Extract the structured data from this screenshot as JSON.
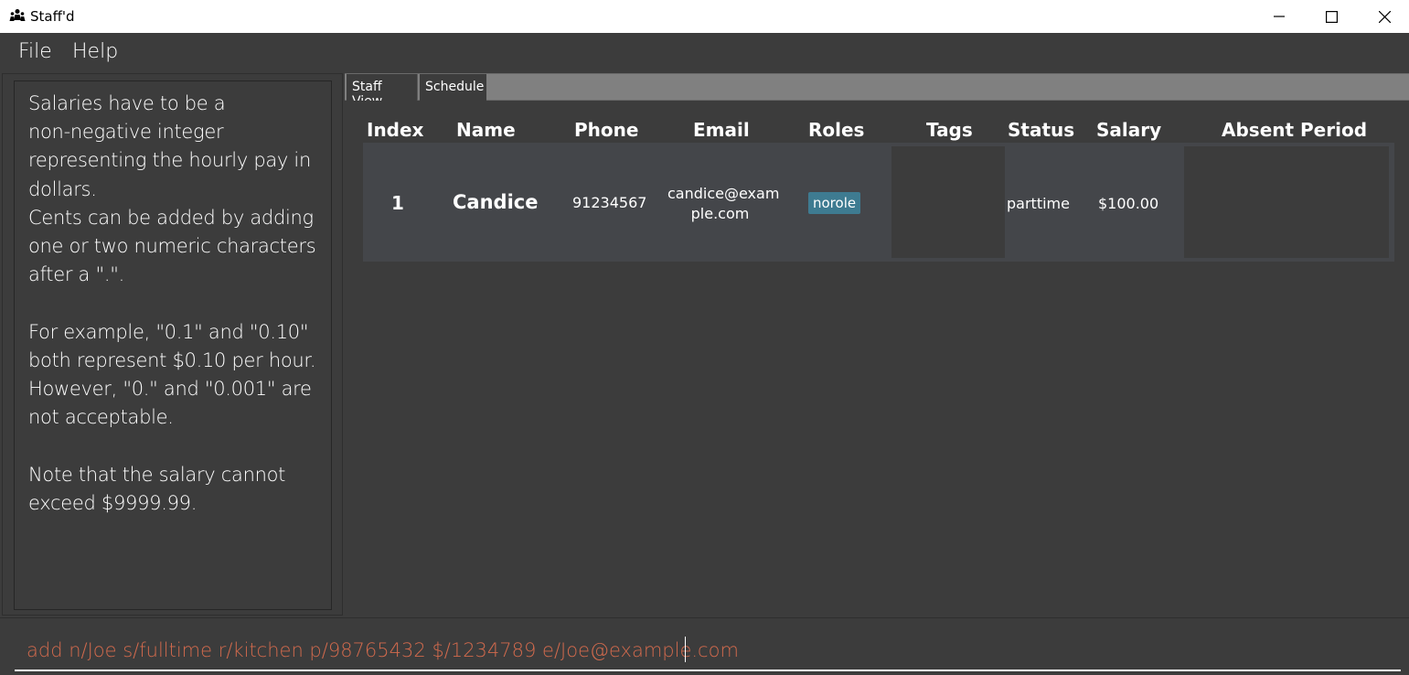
{
  "window": {
    "title": "Staff'd",
    "icon": "staff-group-icon"
  },
  "menu": {
    "file": "File",
    "help": "Help"
  },
  "result_display": {
    "text": "Salaries have to be a\nnon-negative integer\nrepresenting the hourly pay in\ndollars.\nCents can be added by adding\none or two numeric characters\nafter a \".\".\n\nFor example, \"0.1\" and \"0.10\"\nboth represent $0.10 per hour.\nHowever, \"0.\" and \"0.001\" are\nnot acceptable.\n\nNote that the salary cannot\nexceed $9999.99."
  },
  "tabs": [
    {
      "label": "Staff View",
      "active": true
    },
    {
      "label": "Schedule",
      "active": false
    }
  ],
  "table": {
    "headers": {
      "index": "Index",
      "name": "Name",
      "phone": "Phone",
      "email": "Email",
      "roles": "Roles",
      "tags": "Tags",
      "status": "Status",
      "salary": "Salary",
      "absent": "Absent Period"
    },
    "rows": [
      {
        "index": "1",
        "name": "Candice",
        "phone": "91234567",
        "email_line1": "candice@exam",
        "email_line2": "ple.com",
        "role": "norole",
        "status": "parttime",
        "salary": "$100.00"
      }
    ]
  },
  "command": {
    "value": "add n/Joe s/fulltime r/kitchen p/98765432 $/1234789 e/Joe@example.com"
  },
  "colors": {
    "background": "#3c3c3c",
    "row": "#44464a",
    "role_tag": "#3e7b91",
    "command_text": "#d26a4d"
  }
}
